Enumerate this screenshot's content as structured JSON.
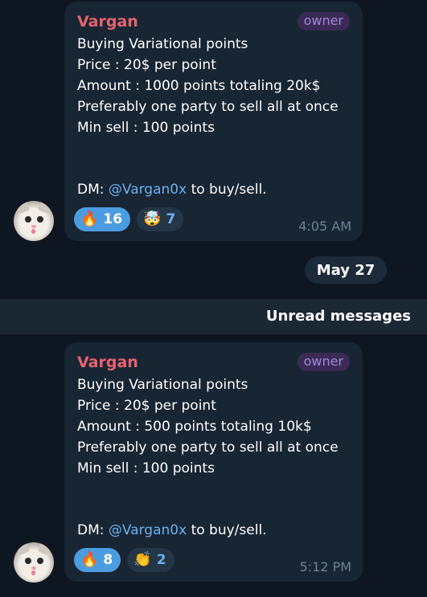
{
  "messages": [
    {
      "sender": "Vargan",
      "badge": "owner",
      "lines": [
        "Buying Variational points",
        "Price : 20$ per point",
        "Amount : 1000 points totaling 20k$",
        "Preferably one party to sell all at once",
        "Min sell : 100 points"
      ],
      "dm_prefix": "DM: ",
      "dm_handle": "@Vargan0x",
      "dm_suffix": " to buy/sell.",
      "reactions": [
        {
          "emoji": "🔥",
          "count": "16",
          "active": true
        },
        {
          "emoji": "🤯",
          "count": "7",
          "active": false
        }
      ],
      "time": "4:05 AM"
    },
    {
      "sender": "Vargan",
      "badge": "owner",
      "lines": [
        "Buying Variational points",
        "Price : 20$ per point",
        "Amount : 500 points totaling 10k$",
        "Preferably one party to sell all at once",
        "Min sell : 100 points"
      ],
      "dm_prefix": "DM: ",
      "dm_handle": "@Vargan0x",
      "dm_suffix": " to buy/sell.",
      "reactions": [
        {
          "emoji": "🔥",
          "count": "8",
          "active": true
        },
        {
          "emoji": "👏",
          "count": "2",
          "active": false
        }
      ],
      "time": "5:12 PM"
    }
  ],
  "date_separator": "May 27",
  "unread_label": "Unread messages",
  "colors": {
    "background": "#0e1621",
    "bubble": "#182533",
    "sender": "#e8626f",
    "link": "#6ab2f2",
    "reaction_active": "#4c9ce2"
  }
}
